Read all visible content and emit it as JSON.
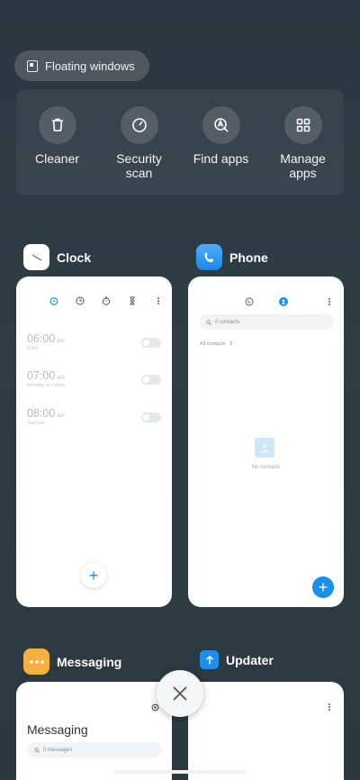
{
  "floating_windows": {
    "label": "Floating windows"
  },
  "tools": [
    {
      "label": "Cleaner",
      "icon": "trash-icon"
    },
    {
      "label": "Security\nscan",
      "icon": "speedometer-icon"
    },
    {
      "label": "Find apps",
      "icon": "app-search-icon"
    },
    {
      "label": "Manage\napps",
      "icon": "grid-icon"
    }
  ],
  "apps": {
    "clock": {
      "name": "Clock",
      "alarms": [
        {
          "time": "06:00",
          "ampm": "am",
          "repeat": "Daily"
        },
        {
          "time": "07:00",
          "ampm": "am",
          "repeat": "Monday to Friday"
        },
        {
          "time": "08:00",
          "ampm": "am",
          "repeat": "Sat-Sun"
        }
      ],
      "add_label": "+"
    },
    "phone": {
      "name": "Phone",
      "search_placeholder": "0 contacts",
      "filter": "All contacts",
      "empty_text": "No contacts",
      "add_label": "+"
    },
    "messaging": {
      "name": "Messaging",
      "title": "Messaging",
      "search_placeholder": "0 messages"
    },
    "updater": {
      "name": "Updater"
    }
  },
  "colors": {
    "accent": "#1a8ff0",
    "background": "#2d3a42"
  }
}
